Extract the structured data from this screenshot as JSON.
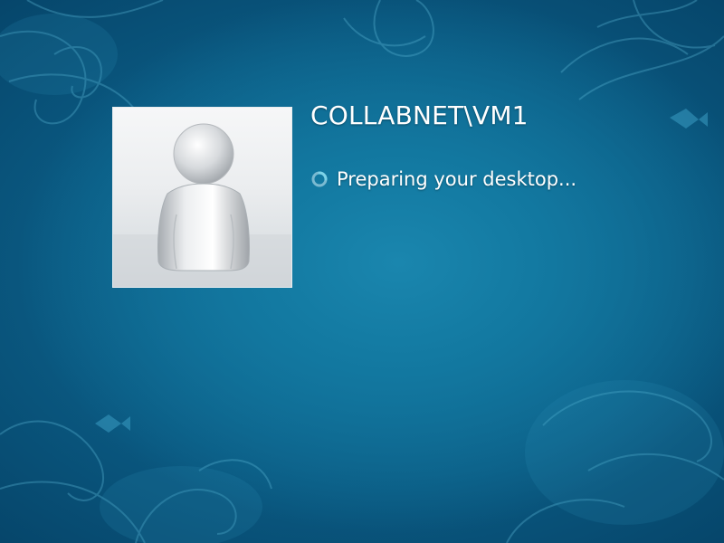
{
  "login": {
    "username": "COLLABNET\\VM1",
    "status": "Preparing your desktop..."
  },
  "icons": {
    "avatar": "default-user-icon",
    "spinner": "busy-spinner-icon"
  },
  "colors": {
    "background": "#0a5a82",
    "text": "#ffffff",
    "spinner_accent": "#7cd3e8"
  }
}
